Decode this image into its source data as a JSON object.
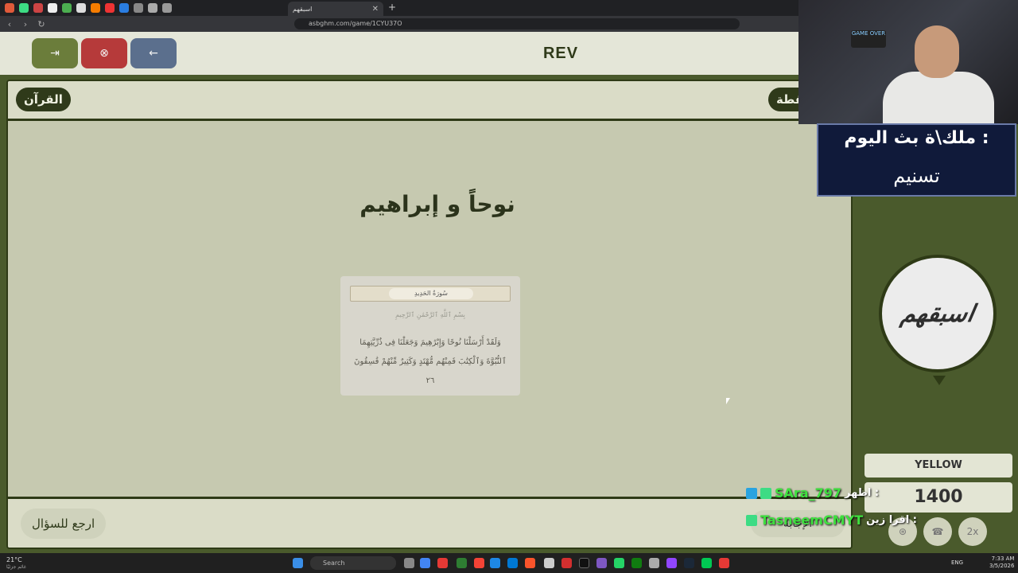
{
  "browser": {
    "tab_title": "اسبقهم",
    "tab_close": "✕",
    "new_tab": "+",
    "url": "asbghm.com/game/1CYU37O",
    "back": "‹",
    "forward": "›",
    "reload": "↻"
  },
  "game": {
    "logo": "REV",
    "buttons": {
      "exit_icon": "⇥",
      "cancel_icon": "⊗",
      "back_icon": "←"
    },
    "category_left": "القرآن",
    "category_right": "نقطة",
    "question": "نوحاً و إبراهيم",
    "ayah": {
      "surah": "سُورَةُ الحَدِيدِ",
      "basmala": "بِسْمِ ٱللَّهِ ٱلرَّحْمَٰنِ ٱلرَّحِيمِ",
      "text": "وَلَقَدْ أَرْسَلْنَا نُوحًا وَإِبْرَٰهِيمَ وَجَعَلْنَا فِى ذُرِّيَّتِهِمَا ٱلنُّبُوَّةَ وَٱلْكِتَٰبَ فَمِنْهُم مُّهْتَدٍ وَكَثِيرٌ مِّنْهُمْ فَٰسِقُونَ ٢٦"
    },
    "back_to_question": "ارجع للسؤال",
    "reveal_answer": "الإجابة"
  },
  "team": {
    "logo_text": "اسبقهم",
    "name": "YELLOW",
    "score": "1400",
    "tools": [
      "⊛",
      "☎",
      "2x"
    ]
  },
  "stream": {
    "banner_title": "ملك\\ة بث اليوم :",
    "banner_name": "تسنيم",
    "cam_sign": "GAME OVER",
    "chat": [
      {
        "user": "SAra_797",
        "message": "اظهر :"
      },
      {
        "user": "TasneemCMYT",
        "message": "اقرا زين :"
      }
    ]
  },
  "taskbar": {
    "temp": "21°C",
    "weather": "غائم جزئيًا",
    "search": "Search",
    "lang": "ENG",
    "time": "7:33 AM",
    "date": "3/5/2026"
  }
}
